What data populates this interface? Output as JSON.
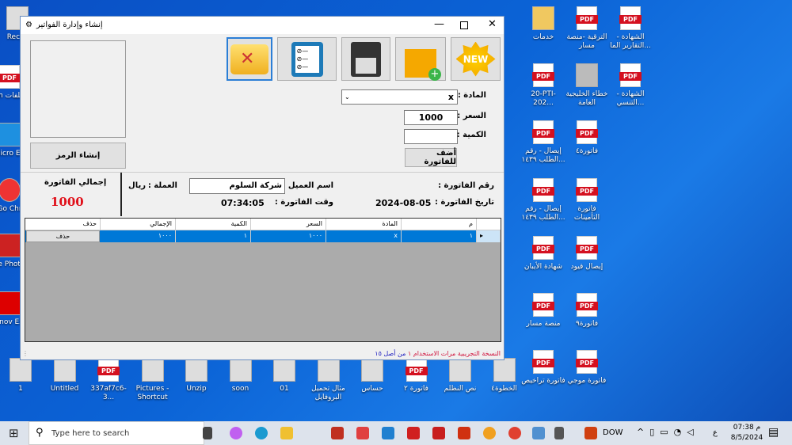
{
  "desktop": {
    "left_icons": [
      "Recyc",
      "Gm مخلفات",
      "Micro Ed",
      "Go Chr",
      "Le Photo",
      "Lenov Exp"
    ],
    "right_icons": [
      {
        "label": "خدمات",
        "type": "folder"
      },
      {
        "label": "الترقية -منصة مسار",
        "type": "pdf"
      },
      {
        "label": "الشهادة - التقارير الما...",
        "type": "pdf"
      },
      {
        "label": "20-PTI-202...",
        "type": "pdf"
      },
      {
        "label": "خطاء الخليجية العامة",
        "type": "image"
      },
      {
        "label": "الشهادة - التنسي...",
        "type": "pdf"
      },
      {
        "label": "إيصال - رقم الطلب ١٤٣٩...",
        "type": "pdf"
      },
      {
        "label": "فاتورة٤",
        "type": "pdf"
      },
      {
        "label": "إيصال - رقم الطلب ١٤٣٩...",
        "type": "pdf"
      },
      {
        "label": "فاتورة التأمينات",
        "type": "pdf"
      },
      {
        "label": "شهادة الأيبان",
        "type": "pdf"
      },
      {
        "label": "إيصال قيود",
        "type": "pdf"
      },
      {
        "label": "منصة مسار",
        "type": "pdf"
      },
      {
        "label": "فاتورة٩",
        "type": "pdf"
      },
      {
        "label": "فاتورة تراخيص",
        "type": "pdf"
      },
      {
        "label": "فاتورة موجي",
        "type": "pdf"
      }
    ],
    "bottom_icons": [
      "1",
      "Untitled",
      "337af7c6-3...",
      "Pictures - Shortcut",
      "Unzip",
      "soon",
      "01",
      "مثال تحميل البروفايل",
      "حساس",
      "فاتورة ٢",
      "نص النظلم",
      "الخطوة٤"
    ],
    "pdf_badge": "PDF"
  },
  "window": {
    "title": "إنشاء وإدارة الفواتير",
    "toolbar": [
      {
        "name": "tools"
      },
      {
        "name": "checklist"
      },
      {
        "name": "save"
      },
      {
        "name": "add-bag"
      },
      {
        "name": "new",
        "text": "NEW"
      }
    ],
    "generate_code_button": "إنشاء الرمز",
    "item_label": "المادة :",
    "item_value": "x",
    "price_label": "السعر :",
    "price_value": "1000",
    "qty_label": "الكمية :",
    "qty_value": "",
    "add_button": "أضف للفاتورة",
    "total_label": "إجمالي الفاتورة",
    "total_value": "1000",
    "invoice_no_label": "رقم الفاتورة :",
    "customer_label": "اسم العميل :",
    "customer_value": "شركة السلوم",
    "currency_label": "العملة :",
    "currency_value": "ريال",
    "date_label": "تاريخ الفاتورة :",
    "date_value": "2024-08-05",
    "time_label": "وقت الفاتورة :",
    "time_value": "07:34:05",
    "grid": {
      "headers": [
        "م",
        "المادة",
        "السعر",
        "الكمية",
        "الإجمالي",
        "حذف"
      ],
      "rows": [
        [
          "١",
          "x",
          "١٠٠٠",
          "١",
          "١٠٠٠",
          "حذف"
        ]
      ]
    },
    "status": {
      "trial": "النسخة التجريبية",
      "uses": "مرات الاستخدام",
      "count": "١",
      "of": "من أصل ١٥"
    }
  },
  "taskbar": {
    "search_placeholder": "Type here to search",
    "app_label": "DOW",
    "time": "07:38 م",
    "date": "8/5/2024",
    "lang": "ع"
  },
  "colors": {
    "total": "#e0101a",
    "selection": "#0078d7"
  }
}
